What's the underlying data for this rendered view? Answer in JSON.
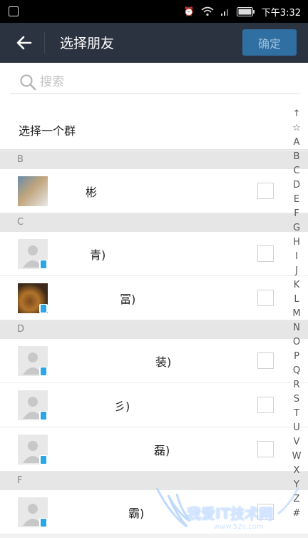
{
  "status_bar": {
    "time": "下午3:32"
  },
  "header": {
    "title": "选择朋友",
    "confirm_label": "确定"
  },
  "search": {
    "placeholder": "搜索"
  },
  "group": {
    "label": "选择一个群"
  },
  "sections": [
    {
      "letter": "B"
    },
    {
      "letter": "C"
    },
    {
      "letter": "D"
    },
    {
      "letter": "F"
    }
  ],
  "contacts": [
    {
      "name": "彬"
    },
    {
      "name": "青)"
    },
    {
      "name": "冨)"
    },
    {
      "name": "装)"
    },
    {
      "name": "彡)"
    },
    {
      "name": "磊)"
    },
    {
      "name": "霸)"
    }
  ],
  "alpha_index": [
    "↑",
    "☆",
    "A",
    "B",
    "C",
    "D",
    "E",
    "F",
    "G",
    "H",
    "I",
    "J",
    "K",
    "L",
    "M",
    "N",
    "O",
    "P",
    "Q",
    "R",
    "S",
    "T",
    "U",
    "V",
    "W",
    "X",
    "Y",
    "Z",
    "#"
  ],
  "watermark": {
    "text": "我爱IT技术网",
    "url": "www.52ij.com"
  },
  "colors": {
    "title_bar": "#2b3240",
    "confirm_button": "#2f6fa2",
    "phone_badge": "#2aa7e8"
  }
}
